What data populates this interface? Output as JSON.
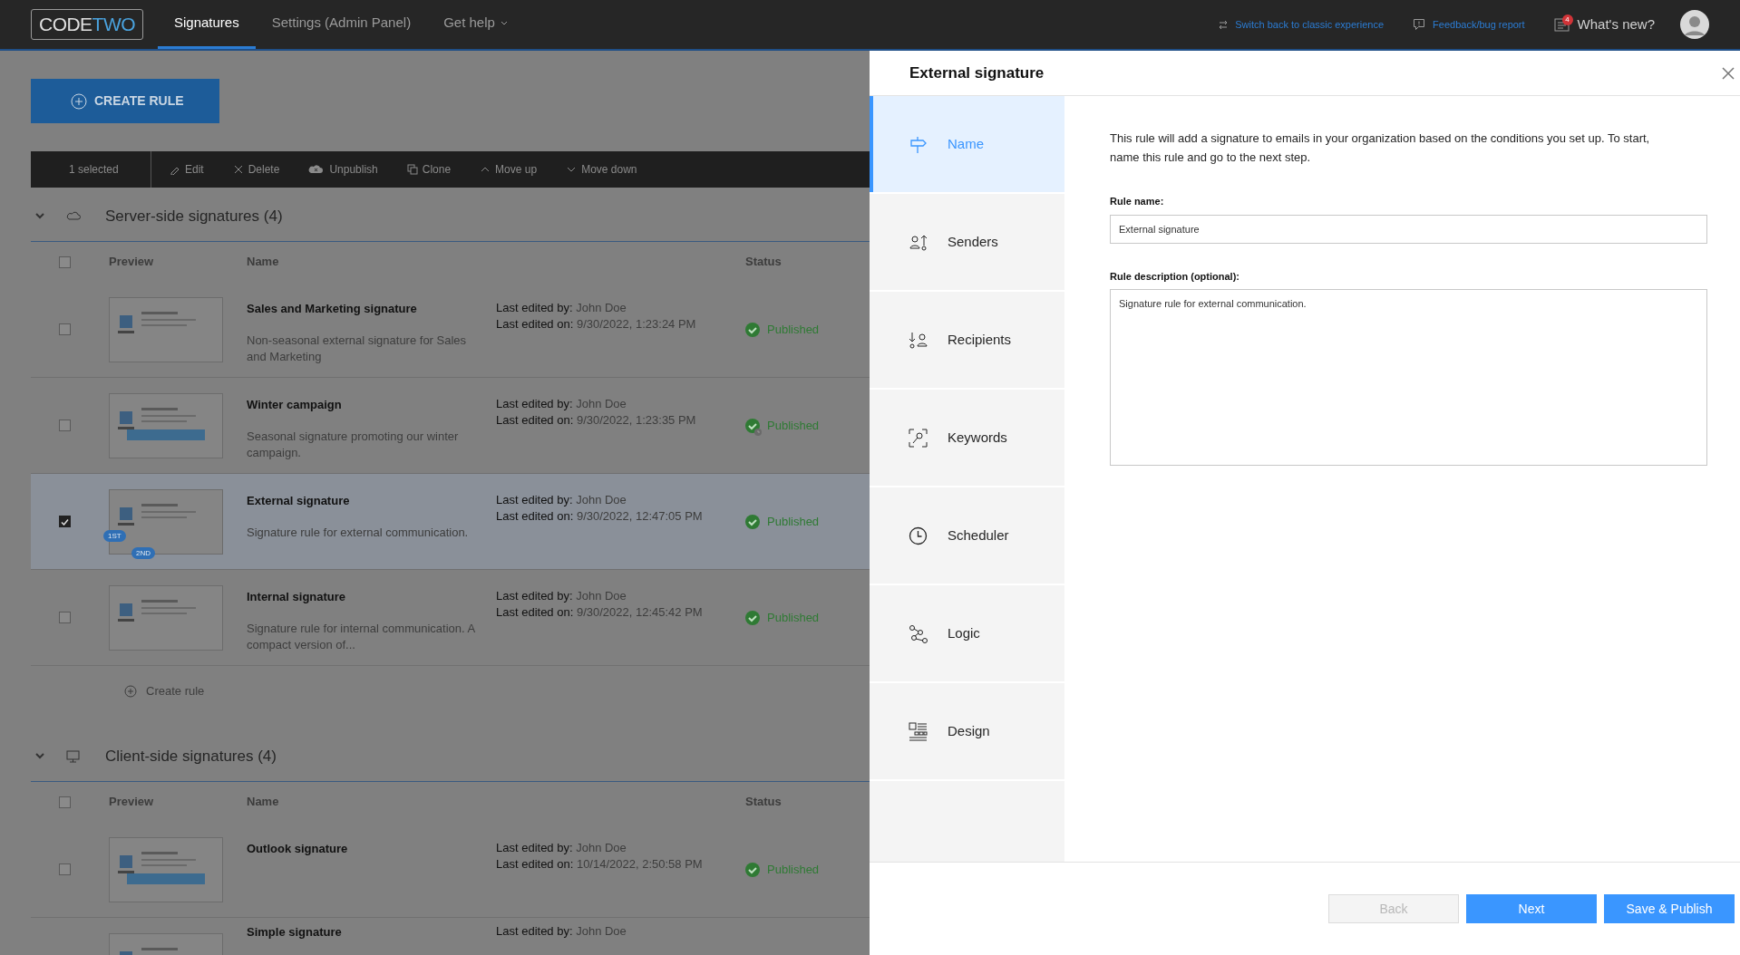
{
  "top_bar": {
    "logo": {
      "first": "CODE",
      "second": "TWO"
    },
    "nav": [
      {
        "label": "Signatures",
        "selected": true,
        "dropdown": false
      },
      {
        "label": "Settings (Admin Panel)",
        "selected": false,
        "dropdown": false
      },
      {
        "label": "Get help",
        "selected": false,
        "dropdown": true
      }
    ],
    "links": [
      {
        "label": "Switch back to classic experience",
        "kind": "switch"
      },
      {
        "label": "Feedback/bug report",
        "kind": "feedback"
      }
    ],
    "whats_new": {
      "label": "What's new?",
      "badge": "4"
    }
  },
  "create_rule": "CREATE RULE",
  "toolbar": {
    "selection": "1 selected",
    "actions": [
      {
        "label": "Edit",
        "kind": "edit"
      },
      {
        "label": "Delete",
        "kind": "delete"
      },
      {
        "label": "Unpublish",
        "kind": "unpublish"
      },
      {
        "label": "Clone",
        "kind": "clone"
      },
      {
        "label": "Move up",
        "kind": "up"
      },
      {
        "label": "Move down",
        "kind": "down"
      }
    ]
  },
  "sections": [
    {
      "title": "Server-side signatures (4)",
      "kind": "cloud",
      "header_checked": false,
      "columns": [
        "Preview",
        "Name",
        "Status"
      ],
      "add_label": "Create rule",
      "rows": [
        {
          "name": "Sales and Marketing signature",
          "description": "Non-seasonal external signature for Sales and Marketing",
          "edited_by_label": "Last edited by:",
          "edited_by": "John Doe",
          "edited_on_label": "Last edited on:",
          "edited_on": "9/30/2022, 1:23:24 PM",
          "status": "Published",
          "scheduled": false,
          "selected": false
        },
        {
          "name": "Winter campaign",
          "description": "Seasonal signature promoting our winter campaign.",
          "edited_by_label": "Last edited by:",
          "edited_by": "John Doe",
          "edited_on_label": "Last edited on:",
          "edited_on": "9/30/2022, 1:23:35 PM",
          "status": "Published",
          "scheduled": true,
          "selected": false
        },
        {
          "name": "External signature",
          "description": "Signature rule for external communication.",
          "edited_by_label": "Last edited by:",
          "edited_by": "John Doe",
          "edited_on_label": "Last edited on:",
          "edited_on": "9/30/2022, 12:47:05 PM",
          "status": "Published",
          "scheduled": false,
          "selected": true,
          "badges": [
            "1ST",
            "2ND"
          ]
        },
        {
          "name": "Internal signature",
          "description": "Signature rule for internal communication. A compact version of...",
          "edited_by_label": "Last edited by:",
          "edited_by": "John Doe",
          "edited_on_label": "Last edited on:",
          "edited_on": "9/30/2022, 12:45:42 PM",
          "status": "Published",
          "scheduled": false,
          "selected": false
        }
      ]
    },
    {
      "title": "Client-side signatures (4)",
      "kind": "desktop",
      "header_checked": false,
      "columns": [
        "Preview",
        "Name",
        "Status"
      ],
      "rows": [
        {
          "name": "Outlook signature",
          "edited_by_label": "Last edited by:",
          "edited_by": "John Doe",
          "edited_on_label": "Last edited on:",
          "edited_on": "10/14/2022, 2:50:58 PM",
          "status": "Published",
          "scheduled": false,
          "selected": false
        },
        {
          "name": "Simple signature",
          "edited_by_label": "Last edited by:",
          "edited_by": "John Doe"
        }
      ]
    }
  ],
  "panel": {
    "title": "External signature",
    "intro": "This rule will add a signature to emails in your organization based on the conditions you set up. To start, name this rule and go to the next step.",
    "steps": [
      {
        "label": "Name",
        "kind": "sign",
        "selected": true
      },
      {
        "label": "Senders",
        "kind": "senders",
        "selected": false
      },
      {
        "label": "Recipients",
        "kind": "recipients",
        "selected": false
      },
      {
        "label": "Keywords",
        "kind": "keywords",
        "selected": false
      },
      {
        "label": "Scheduler",
        "kind": "clock",
        "selected": false
      },
      {
        "label": "Logic",
        "kind": "logic",
        "selected": false
      },
      {
        "label": "Design",
        "kind": "design",
        "selected": false
      }
    ],
    "rule_name": {
      "label": "Rule name:",
      "value": "External signature"
    },
    "rule_description": {
      "label": "Rule description (optional):",
      "value": "Signature rule for external communication."
    },
    "buttons": [
      {
        "label": "Back",
        "kind": "secondary",
        "disabled": true
      },
      {
        "label": "Next",
        "kind": "primary",
        "disabled": false
      },
      {
        "label": "Save & Publish",
        "kind": "primary",
        "disabled": false
      }
    ]
  }
}
